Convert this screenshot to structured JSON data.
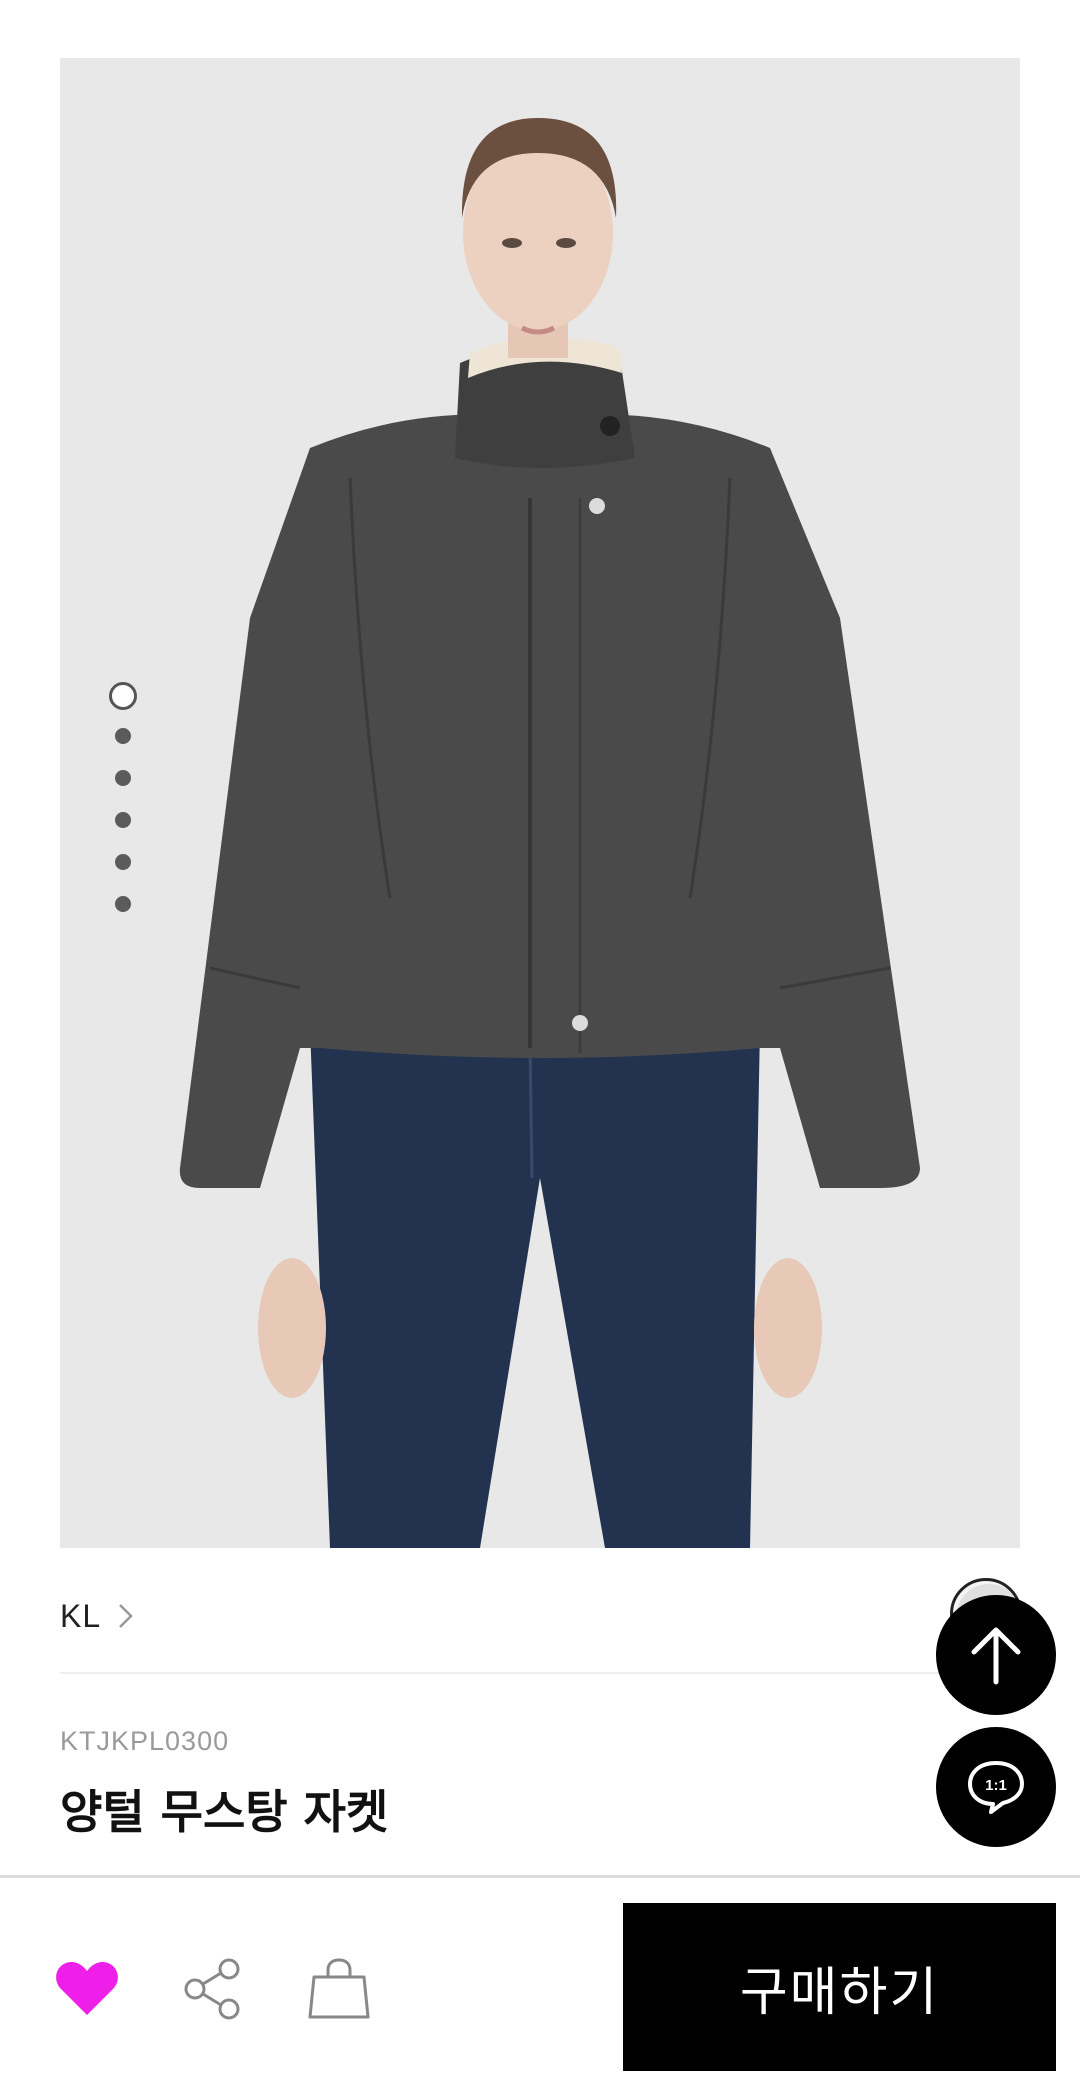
{
  "gallery": {
    "image_alt": "Model wearing grey wool jacket with shearling stand collar and dark jeans",
    "dot_count": 6,
    "active_index": 0
  },
  "brand": {
    "name": "KL"
  },
  "product": {
    "code": "KTJKPL0300",
    "name": "양털 무스탕 자켓"
  },
  "fabs": {
    "scroll_top_icon": "arrow-up-icon",
    "chat_icon": "chat-bubble-icon",
    "chat_text": "1:1"
  },
  "bottom_bar": {
    "wishlist_icon": "heart-icon",
    "share_icon": "share-icon",
    "cart_icon": "shopping-bag-icon",
    "buy_label": "구매하기"
  },
  "colors": {
    "wishlist_active": "#ee1fe9",
    "buy_button_bg": "#000000",
    "fab_bg": "#000000"
  }
}
